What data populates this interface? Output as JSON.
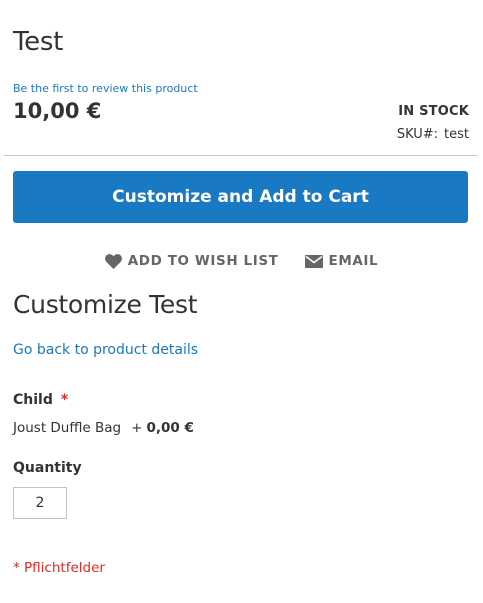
{
  "product": {
    "title": "Test",
    "review_link": "Be the first to review this product",
    "price": "10,00 €",
    "stock_status": "IN STOCK",
    "sku_label": "SKU#:",
    "sku_value": "test"
  },
  "cta": {
    "label": "Customize and Add to Cart",
    "color": "#1979c3"
  },
  "actions": {
    "wishlist": {
      "label": "ADD TO WISH LIST",
      "icon": "heart-icon"
    },
    "email": {
      "label": "EMAIL",
      "icon": "envelope-icon"
    }
  },
  "customize": {
    "title": "Customize Test",
    "back_link": "Go back to product details",
    "child": {
      "label": "Child",
      "required_marker": "*",
      "option_name": "Joust Duffle Bag",
      "option_plus": "+",
      "option_price": "0,00 €"
    },
    "quantity": {
      "label": "Quantity",
      "value": "2"
    },
    "required_note": "* Pflichtfelder"
  },
  "colors": {
    "link": "#1979c3",
    "required": "#e02b27"
  }
}
